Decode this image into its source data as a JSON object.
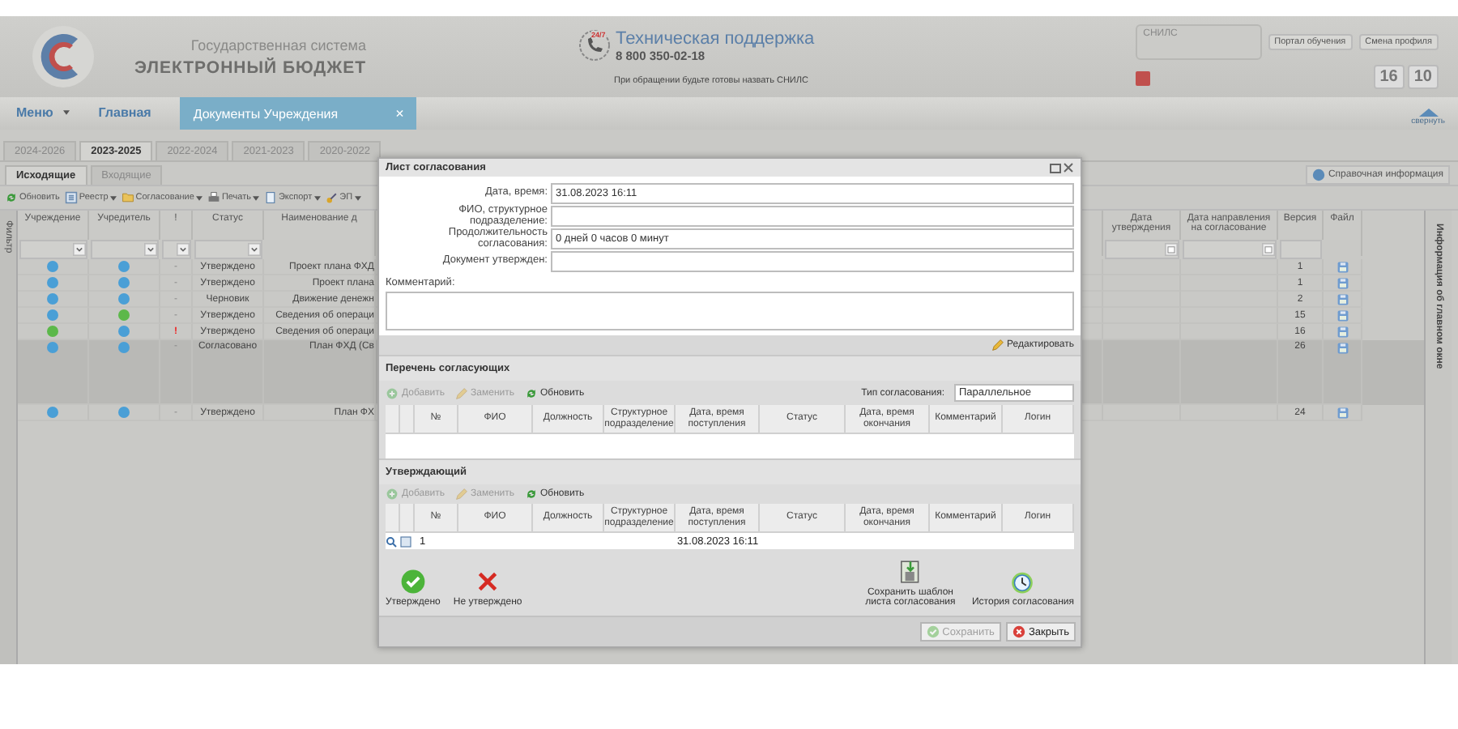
{
  "header": {
    "system_line": "Государственная система",
    "system_name": "ЭЛЕКТРОННЫЙ БЮДЖЕТ",
    "support_badge": "24/7",
    "support_title": "Техническая поддержка",
    "support_phone": "8 800 350-02-18",
    "support_note": "При обращении будьте готовы назвать СНИЛС",
    "snils_label": "СНИЛС",
    "training_link": "Портал обучения",
    "profile_link": "Смена профиля",
    "counters": [
      "16",
      "10"
    ]
  },
  "nav": {
    "menu": "Меню",
    "home": "Главная",
    "tabs": [
      {
        "label": "Документы Учреждения",
        "close": "×",
        "selected": true
      }
    ],
    "collapse": "свернуть"
  },
  "year_tabs": [
    {
      "label": "2024-2026",
      "selected": false
    },
    {
      "label": "2023-2025",
      "selected": true
    },
    {
      "label": "2022-2024",
      "selected": false
    },
    {
      "label": "2021-2023",
      "selected": false
    },
    {
      "label": "2020-2022",
      "selected": false
    }
  ],
  "sub_tabs": [
    {
      "label": "Исходящие",
      "selected": true
    },
    {
      "label": "Входящие",
      "selected": false
    }
  ],
  "toolbar": [
    {
      "label": "Обновить",
      "kind": "refresh",
      "dropdown": false
    },
    {
      "label": "Реестр",
      "kind": "list",
      "dropdown": true
    },
    {
      "label": "Согласование",
      "kind": "folder",
      "dropdown": true
    },
    {
      "label": "Печать",
      "kind": "print",
      "dropdown": true
    },
    {
      "label": "Экспорт",
      "kind": "export",
      "dropdown": true
    },
    {
      "label": "ЭП",
      "kind": "key",
      "dropdown": true
    }
  ],
  "help_button": "Справочная информация",
  "filter_panel": "Фильтр",
  "info_panel": "Информация об главном окне",
  "grid": {
    "left_columns": [
      "Учреждение",
      "Учредитель",
      "!",
      "Статус",
      "Наименование д"
    ],
    "right_columns": [
      "Дата утверждения",
      "Дата направления на согласование",
      "Версия",
      "Файл"
    ],
    "rows": [
      {
        "institution": {
          "color": "#4a9fd6"
        },
        "founder": {
          "color": "#4a9fd6"
        },
        "flag": "-",
        "alert": false,
        "status": "Утверждено",
        "name": "Проект плана ФХД",
        "version": "1",
        "selected": false
      },
      {
        "institution": {
          "color": "#4a9fd6"
        },
        "founder": {
          "color": "#4a9fd6"
        },
        "flag": "-",
        "alert": false,
        "status": "Утверждено",
        "name": "Проект плана",
        "version": "1",
        "selected": false
      },
      {
        "institution": {
          "color": "#4a9fd6"
        },
        "founder": {
          "color": "#4a9fd6"
        },
        "flag": "-",
        "alert": false,
        "status": "Черновик",
        "name": "Движение денежн",
        "version": "2",
        "selected": false
      },
      {
        "institution": {
          "color": "#4a9fd6"
        },
        "founder": {
          "color": "#5cb84a"
        },
        "flag": "-",
        "alert": false,
        "status": "Утверждено",
        "name": "Сведения об операци",
        "version": "15",
        "selected": false
      },
      {
        "institution": {
          "color": "#5cb84a"
        },
        "founder": {
          "color": "#4a9fd6"
        },
        "flag": "!",
        "alert": true,
        "status": "Утверждено",
        "name": "Сведения об операци",
        "version": "16",
        "selected": false
      },
      {
        "institution": {
          "color": "#4a9fd6"
        },
        "founder": {
          "color": "#4a9fd6"
        },
        "flag": "-",
        "alert": false,
        "status": "Согласовано",
        "name": "План ФХД (Св",
        "version": "26",
        "selected": true
      },
      {
        "institution": {
          "color": "#4a9fd6"
        },
        "founder": {
          "color": "#4a9fd6"
        },
        "flag": "-",
        "alert": false,
        "status": "Утверждено",
        "name": "План ФХ",
        "version": "24",
        "selected": false
      }
    ]
  },
  "dialog": {
    "title": "Лист согласования",
    "fields": [
      {
        "label": "Дата, время:",
        "value": "31.08.2023 16:11"
      },
      {
        "label": "ФИО, структурное подразделение:"
      },
      {
        "label": "Продолжительность согласования:",
        "value": "0 дней 0 часов 0 минут"
      },
      {
        "label": "Документ утвержден:"
      }
    ],
    "comment_label": "Комментарий:",
    "edit_button": "Редактировать",
    "sections": [
      {
        "title": "Перечень согласующих",
        "type_label": "Тип согласования:",
        "type_value": "Параллельное",
        "toolbar": [
          {
            "label": "Добавить",
            "kind": "add",
            "disabled": true
          },
          {
            "label": "Заменить",
            "kind": "edit",
            "disabled": true
          },
          {
            "label": "Обновить",
            "kind": "refresh",
            "disabled": false
          }
        ],
        "columns": [
          "№",
          "ФИО",
          "Должность",
          "Структурное подразделение",
          "Дата, время поступления",
          "Статус",
          "Дата, время окончания",
          "Комментарий",
          "Логин"
        ]
      },
      {
        "title": "Утверждающий",
        "toolbar": [
          {
            "label": "Добавить",
            "kind": "add",
            "disabled": true
          },
          {
            "label": "Заменить",
            "kind": "edit",
            "disabled": true
          },
          {
            "label": "Обновить",
            "kind": "refresh",
            "disabled": false
          }
        ],
        "columns": [
          "№",
          "ФИО",
          "Должность",
          "Структурное подразделение",
          "Дата, время поступления",
          "Статус",
          "Дата, время окончания",
          "Комментарий",
          "Логин"
        ],
        "rows": [
          {
            "number": "1",
            "received": "31.08.2023 16:11"
          }
        ]
      }
    ],
    "actions": [
      {
        "label": "Утверждено",
        "kind": "check"
      },
      {
        "label": "Не утверждено",
        "kind": "cross"
      },
      {
        "label": "Сохранить шаблон листа согласования",
        "kind": "save"
      },
      {
        "label": "История согласования",
        "kind": "clock"
      }
    ],
    "footer": [
      {
        "label": "Сохранить",
        "kind": "check",
        "disabled": true
      },
      {
        "label": "Закрыть",
        "kind": "close",
        "disabled": false
      }
    ]
  }
}
